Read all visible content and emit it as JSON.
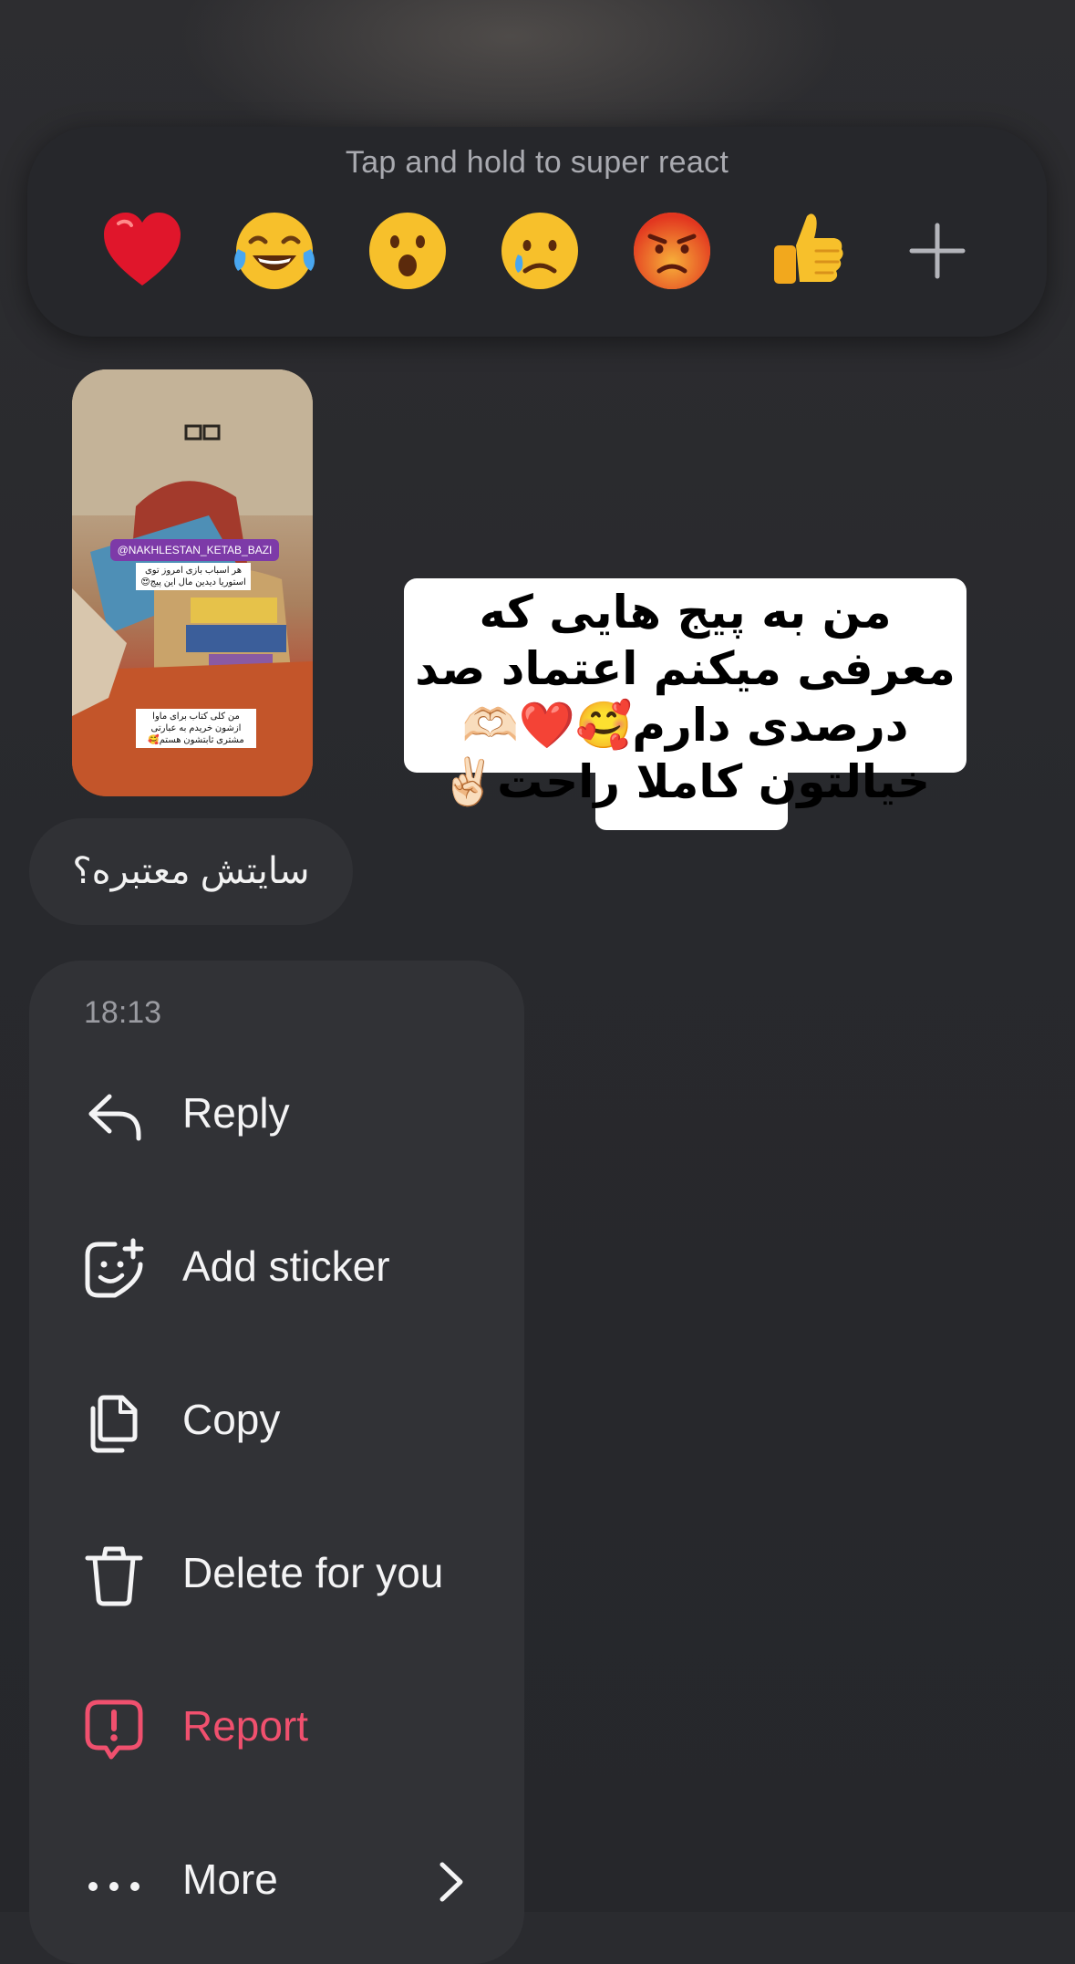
{
  "reactions": {
    "hint": "Tap and hold to super react",
    "items": [
      "heart",
      "face-with-tears-of-joy",
      "face-with-open-mouth",
      "crying-face",
      "angry-face",
      "thumbs-up",
      "add"
    ]
  },
  "story": {
    "label": "@NAKHLESTAN_KETAB_BAZI",
    "caption_top": "هر اسباب بازی امروز توی استوریا دیدین مال این پیج😍",
    "caption_bottom": "من کلی کتاب برای ماوا ازشون خریدم به عبارتی مشتری ثابتشون هستم🥰"
  },
  "sticker": {
    "text": "من به پیج هایی که معرفی میکنم اعتماد صد درصدی دارم🥰❤️🫶🏻خیالتون کاملا راحت✌🏻"
  },
  "message": {
    "text": "سایتش معتبره؟"
  },
  "menu": {
    "time": "18:13",
    "items": [
      {
        "label": "Reply",
        "icon": "reply-icon"
      },
      {
        "label": "Add sticker",
        "icon": "sticker-icon"
      },
      {
        "label": "Copy",
        "icon": "copy-icon"
      },
      {
        "label": "Delete for you",
        "icon": "trash-icon"
      },
      {
        "label": "Report",
        "icon": "report-icon"
      },
      {
        "label": "More",
        "icon": "more-icon"
      }
    ]
  },
  "colors": {
    "background": "#2a2b2f",
    "menu_bg": "#313236",
    "danger": "#f0506e"
  }
}
